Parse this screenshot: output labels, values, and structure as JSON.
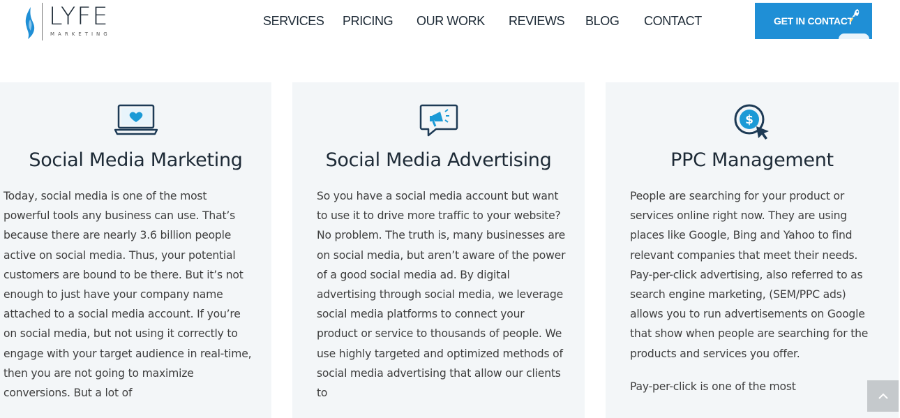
{
  "brand": {
    "name": "LYFE",
    "sub": "MARKETING"
  },
  "nav": {
    "items": [
      {
        "label": "SERVICES"
      },
      {
        "label": "PRICING"
      },
      {
        "label": "OUR WORK"
      },
      {
        "label": "REVIEWS"
      },
      {
        "label": "BLOG"
      },
      {
        "label": "CONTACT"
      }
    ],
    "cta_label": "GET IN CONTACT"
  },
  "colors": {
    "accent": "#1f8fd6",
    "icon_blue": "#1b9ad6",
    "icon_dark": "#1d3a55",
    "card_bg": "#f3f6f8"
  },
  "services": [
    {
      "icon": "laptop-heart-icon",
      "title": "Social Media Marketing",
      "paragraphs": [
        "Today, social media is one of the most powerful tools any business can use. That’s because there are nearly 3.6 billion people active on social media. Thus, your potential customers are bound to be there. But it’s not enough to just have your company name attached to a social media account. If you’re on social media, but not using it correctly to engage with your target audience in real-time, then you are not going to maximize conversions. But a lot of"
      ]
    },
    {
      "icon": "megaphone-chat-icon",
      "title": "Social Media Advertising",
      "paragraphs": [
        "So you have a social media account but want to use it to drive more traffic to your website? No problem. The truth is, many businesses are on social media, but aren’t aware of the power of a good social media ad. By digital advertising through social media, we leverage social media platforms to connect your product or service to thousands of people. We use highly targeted and optimized methods of social media advertising that allow our clients to"
      ]
    },
    {
      "icon": "dollar-click-icon",
      "title": "PPC Management",
      "paragraphs": [
        "People are searching for your product or services online right now. They are using places like Google, Bing and Yahoo to find relevant companies that meet their needs. Pay-per-click advertising, also referred to as search engine marketing, (SEM/PPC ads) allows you to run advertisements on Google that show when people are searching for the products and services you offer.",
        "Pay-per-click is one of the most"
      ]
    }
  ]
}
